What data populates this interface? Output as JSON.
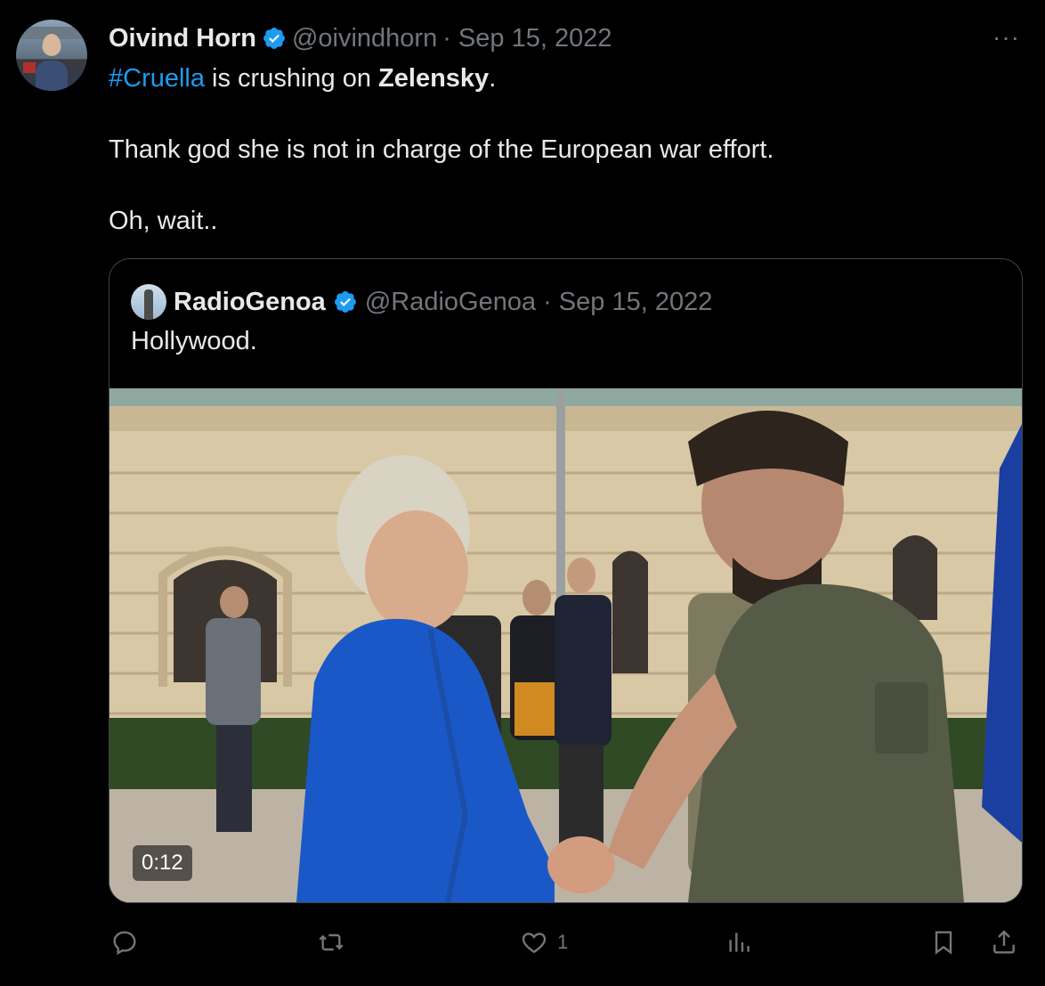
{
  "tweet": {
    "author_name": "Oivind Horn",
    "author_handle": "@oivindhorn",
    "date": "· Sep 15, 2022",
    "more_label": "···",
    "hashtag": "#Cruella",
    "text_part1": " is crushing on ",
    "bold_word": "Zelensky",
    "text_part2": ".",
    "line2": "Thank god she is not in charge of the European war effort.",
    "line3": "Oh, wait.."
  },
  "quote": {
    "author_name": "RadioGenoa",
    "author_handle": "@RadioGenoa",
    "date": "· Sep 15, 2022",
    "text": "Hollywood.",
    "video_duration": "0:12"
  },
  "actions": {
    "like_count": "1"
  },
  "colors": {
    "accent": "#1d9bf0",
    "muted": "#71767b",
    "text": "#e7e9ea",
    "background": "#000000"
  },
  "icons": [
    "verified-badge-icon",
    "more-icon",
    "reply-icon",
    "retweet-icon",
    "like-icon",
    "views-icon",
    "bookmark-icon",
    "share-icon",
    "video-duration-badge"
  ]
}
